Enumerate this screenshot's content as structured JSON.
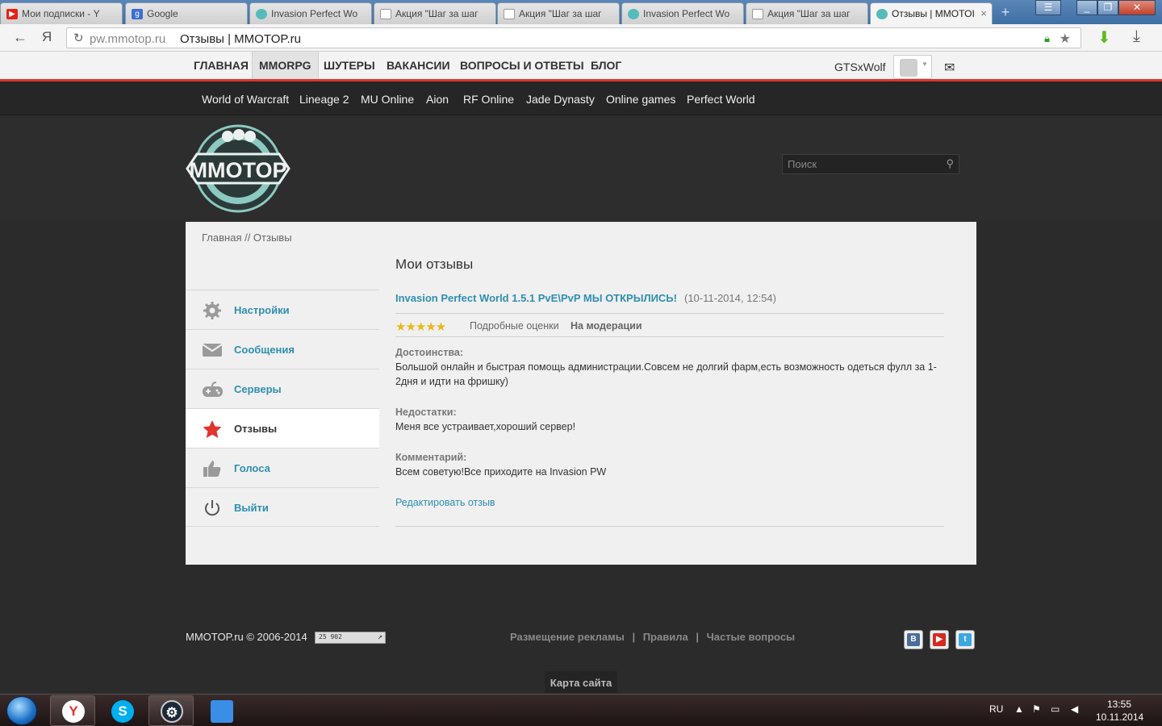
{
  "browser": {
    "tabs": [
      {
        "label": "Мои подписки - Y",
        "icon": "youtube-icon",
        "color": "#e62117"
      },
      {
        "label": "Google",
        "icon": "google-icon",
        "color": "#3b6fd3"
      },
      {
        "label": "Invasion Perfect Wo",
        "icon": "mmotop-icon",
        "color": "#4aa"
      },
      {
        "label": "Акция \"Шаг за шаг",
        "icon": "page-icon",
        "color": "#999"
      },
      {
        "label": "Акция \"Шаг за шаг",
        "icon": "page-icon",
        "color": "#999"
      },
      {
        "label": "Invasion Perfect Wo",
        "icon": "mmotop-icon",
        "color": "#4aa"
      },
      {
        "label": "Акция \"Шаг за шаг",
        "icon": "page-icon",
        "color": "#999"
      },
      {
        "label": "Отзывы | MMOTOI",
        "icon": "mmotop-icon",
        "color": "#4aa",
        "active": true
      }
    ],
    "url_host": "pw.mmotop.ru",
    "url_title": "Отзывы | MMOTOP.ru",
    "ya_label": "Я"
  },
  "topnav": {
    "items": [
      "ГЛАВНАЯ",
      "MMORPG",
      "ШУТЕРЫ",
      "ВАКАНСИИ",
      "ВОПРОСЫ И ОТВЕТЫ",
      "БЛОГ"
    ],
    "active": "MMORPG",
    "username": "GTSxWolf"
  },
  "gamebar": {
    "items": [
      "World of Warcraft",
      "Lineage 2",
      "MU Online",
      "Aion",
      "RF Online",
      "Jade Dynasty",
      "Online games",
      "Perfect World"
    ]
  },
  "header": {
    "search_placeholder": "Поиск"
  },
  "breadcrumb": "Главная // Отзывы",
  "sidebar": {
    "items": [
      {
        "label": "Настройки",
        "icon": "gear-icon"
      },
      {
        "label": "Сообщения",
        "icon": "envelope-icon"
      },
      {
        "label": "Серверы",
        "icon": "gamepad-icon"
      },
      {
        "label": "Отзывы",
        "icon": "star-icon",
        "active": true
      },
      {
        "label": "Голоса",
        "icon": "thumbs-up-icon"
      },
      {
        "label": "Выйти",
        "icon": "power-icon"
      }
    ]
  },
  "main": {
    "title": "Мои отзывы",
    "review": {
      "server": "Invasion Perfect World 1.5.1 PvE\\PvP МЫ ОТКРЫЛИСЬ!",
      "date": "(10-11-2014, 12:54)",
      "rating": 5,
      "stars_text": "★★★★★",
      "details_label": "Подробные оценки",
      "status": "На модерации",
      "pros_label": "Достоинства:",
      "pros": "Большой онлайн и быстрая помощь администрации.Совсем не долгий фарм,есть возможность одеться фулл за 1-2дня и идти на фришку)",
      "cons_label": "Недостатки:",
      "cons": "Меня все устраивает,хороший сервер!",
      "comment_label": "Комментарий:",
      "comment": "Всем советую!Все приходите на Invasion PW",
      "edit_label": "Редактировать отзыв"
    }
  },
  "footer": {
    "copyright": "MMOTOP.ru © 2006-2014",
    "counter": "25 902",
    "links": [
      "Размещение рекламы",
      "|",
      "Правила",
      "|",
      "Частые вопросы"
    ],
    "sitemap": "Карта сайта",
    "social": [
      {
        "name": "vk-icon",
        "color": "#4a6e9a",
        "glyph": "B"
      },
      {
        "name": "youtube-icon",
        "color": "#d42a22",
        "glyph": "▶"
      },
      {
        "name": "twitter-icon",
        "color": "#3ba9e0",
        "glyph": "t"
      }
    ]
  },
  "taskbar": {
    "lang": "RU",
    "time": "13:55",
    "date": "10.11.2014"
  },
  "colors": {
    "accent_red": "#e2332d",
    "link_blue": "#2e8fb0",
    "star_yellow": "#f1b516"
  }
}
